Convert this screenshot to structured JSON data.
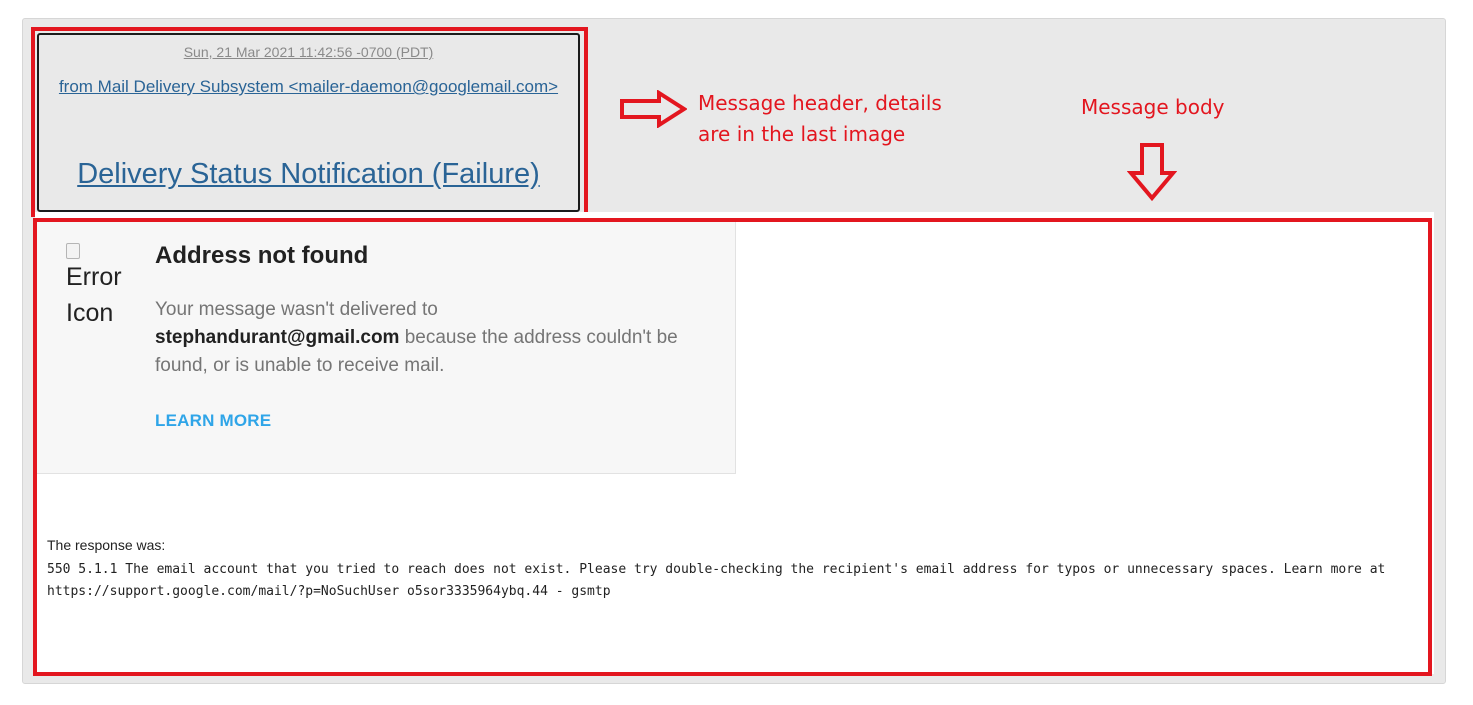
{
  "header": {
    "date": "Sun, 21 Mar 2021 11:42:56 -0700 (PDT)",
    "from": "from Mail Delivery Subsystem <mailer-daemon@googlemail.com>",
    "subject": "Delivery Status Notification (Failure)"
  },
  "annotations": {
    "header_note_line1": "Message header, details",
    "header_note_line2": "are in the last image",
    "body_note": "Message body"
  },
  "card": {
    "icon_alt_line1": "Error",
    "icon_alt_line2": "Icon",
    "title": "Address not found",
    "text_prefix": "Your message wasn't delivered to",
    "email": "stephandurant@gmail.com",
    "text_suffix": " because the address couldn't be found, or is unable to receive mail.",
    "learn_more": "LEARN MORE"
  },
  "response": {
    "label": "The response was:",
    "text": "550 5.1.1 The email account that you tried to reach does not exist. Please try double-checking the recipient's email address for typos or unnecessary spaces. Learn more at https://support.google.com/mail/?p=NoSuchUser o5sor3335964ybq.44 - gsmtp"
  },
  "colors": {
    "annotation_red": "#e3161f",
    "link_blue": "#2a6496",
    "learn_more_blue": "#2fa5e8"
  },
  "icons": [
    "error-icon",
    "right-arrow-icon",
    "down-arrow-icon"
  ]
}
